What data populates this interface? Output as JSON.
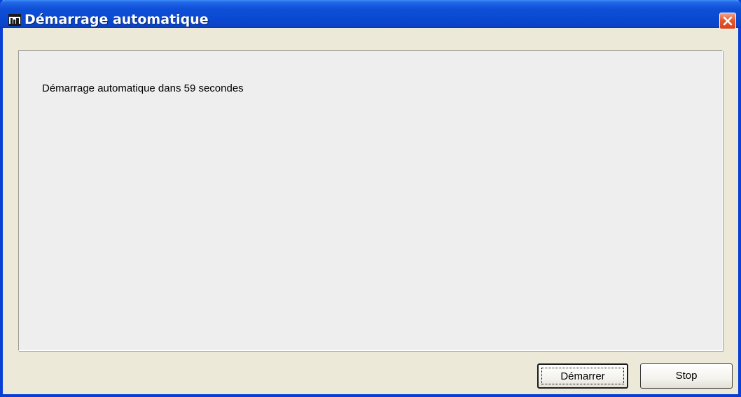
{
  "window": {
    "title": "Démarrage automatique",
    "icon": "app-window-icon"
  },
  "titlebar": {
    "close_icon": "close-icon",
    "close_color": "#e45a32",
    "accent": "#0a48d0"
  },
  "main": {
    "message": "Démarrage automatique dans 59 secondes"
  },
  "buttons": {
    "start_label": "Démarrer",
    "stop_label": "Stop"
  }
}
